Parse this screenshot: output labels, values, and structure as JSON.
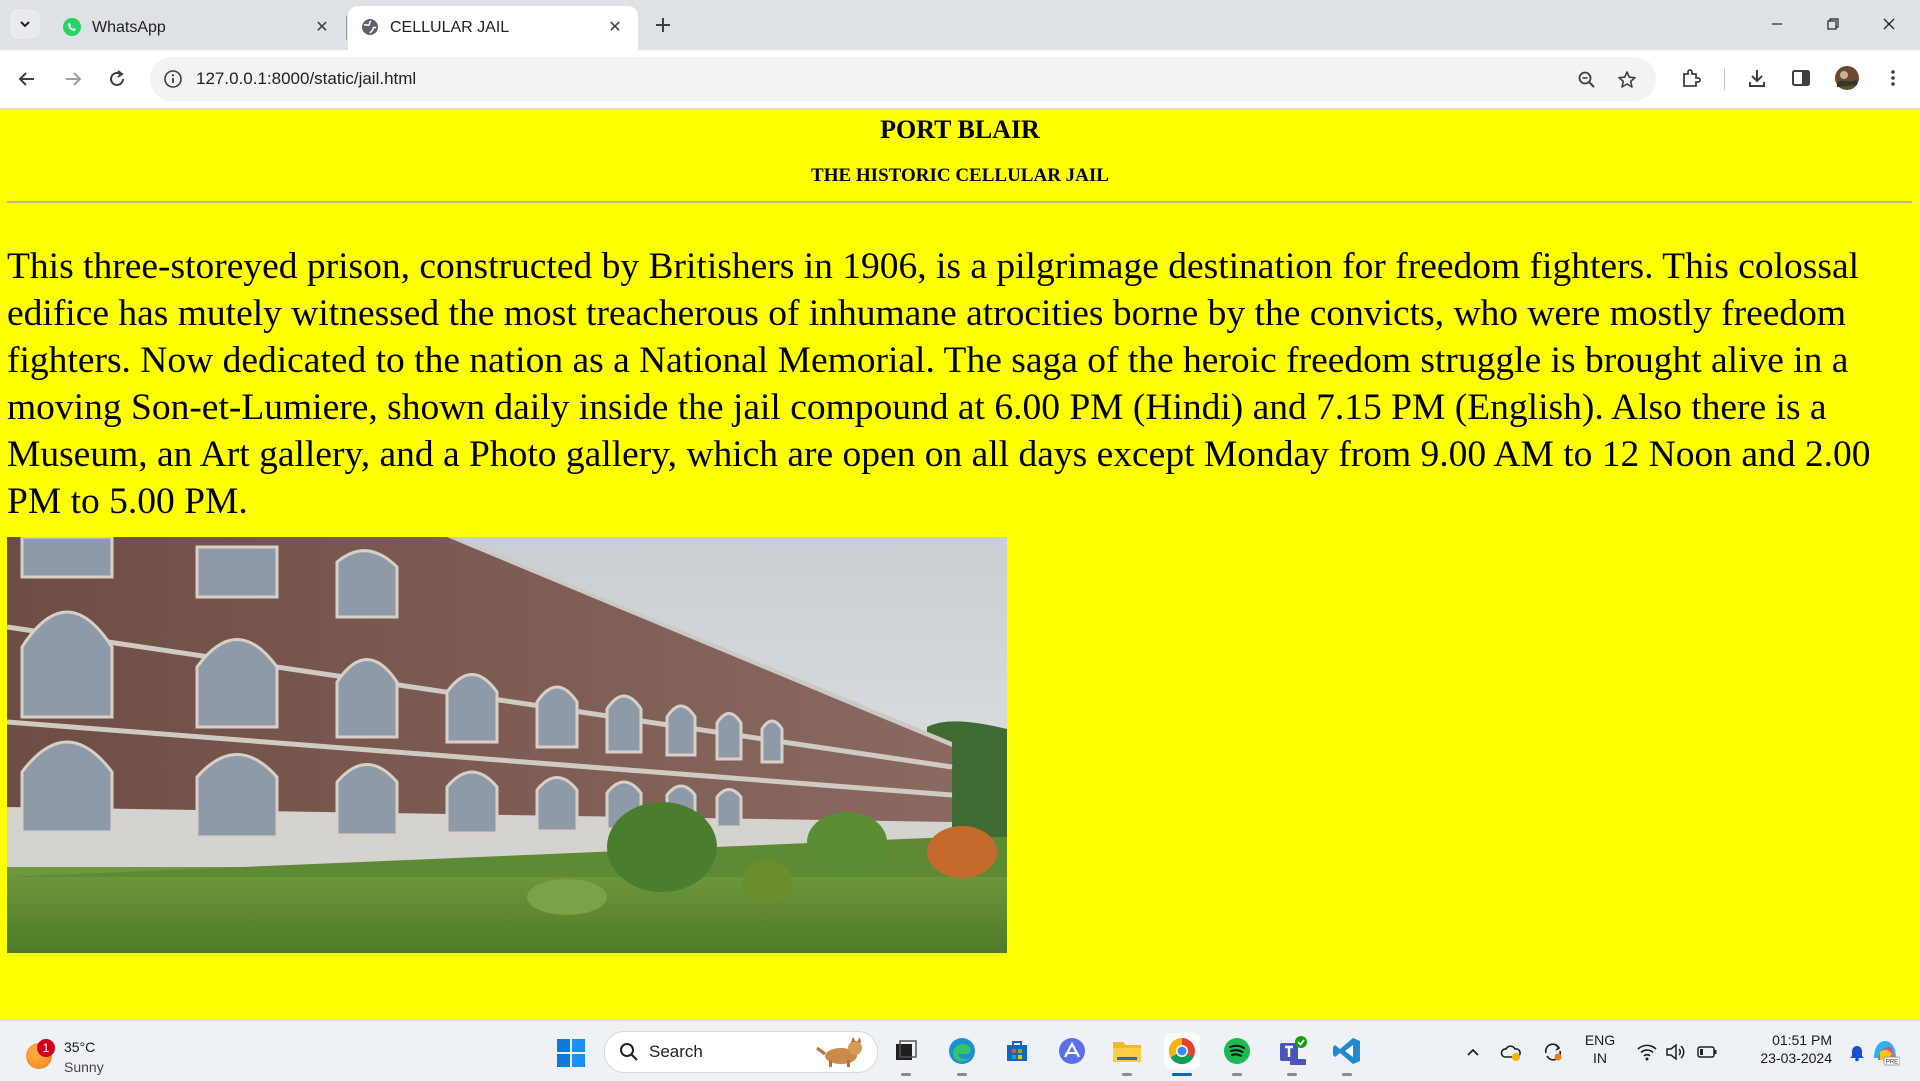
{
  "browser": {
    "tabs": [
      {
        "title": "WhatsApp",
        "icon": "whatsapp-icon",
        "active": false
      },
      {
        "title": "CELLULAR JAIL",
        "icon": "globe-icon",
        "active": true
      }
    ],
    "url": "127.0.0.1:8000/static/jail.html",
    "colors": {
      "tabstrip": "#dee1e6",
      "omnibox": "#f1f3f4",
      "whatsapp": "#25d366"
    }
  },
  "page": {
    "background": "#ffff00",
    "heading": "PORT BLAIR",
    "subheading": "THE HISTORIC CELLULAR JAIL",
    "paragraph": "This three-storeyed prison, constructed by Britishers in 1906, is a pilgrimage destination for freedom fighters. This colossal edifice has mutely witnessed the most treacherous of inhumane atrocities borne by the convicts, who were mostly freedom fighters. Now dedicated to the nation as a National Memorial. The saga of the heroic freedom struggle is brought alive in a moving Son-et-Lumiere, shown daily inside the jail compound at 6.00 PM (Hindi) and 7.15 PM (English). Also there is a Museum, an Art gallery, and a Photo gallery, which are open on all days except Monday from 9.00 AM to 12 Noon and 2.00 PM to 5.00 PM.",
    "image": "cellular-jail-photo"
  },
  "taskbar": {
    "weather": {
      "temp": "35°C",
      "condition": "Sunny",
      "badge": "1"
    },
    "search_label": "Search",
    "apps": [
      "file-explorer-icon",
      "edge-icon",
      "store-icon",
      "affinity-icon",
      "folder-icon",
      "chrome-icon",
      "spotify-icon",
      "teams-icon",
      "vscode-icon"
    ],
    "lang": {
      "line1": "ENG",
      "line2": "IN"
    },
    "clock": {
      "time": "01:51 PM",
      "date": "23-03-2024"
    }
  }
}
